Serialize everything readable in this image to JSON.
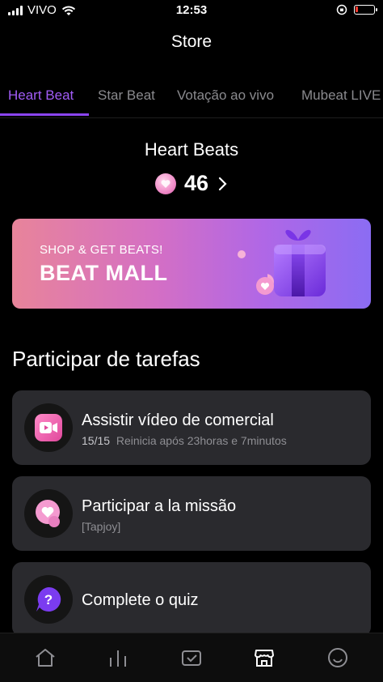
{
  "status": {
    "carrier": "VIVO",
    "time": "12:53",
    "battery_level": 0.15
  },
  "header": {
    "title": "Store"
  },
  "tabs": [
    {
      "label": "Heart Beat",
      "active": true
    },
    {
      "label": "Star Beat",
      "active": false
    },
    {
      "label": "Votação ao vivo",
      "active": false
    },
    {
      "label": "Mubeat LIVE",
      "active": false
    }
  ],
  "beats": {
    "title": "Heart Beats",
    "count": "46"
  },
  "banner": {
    "subtitle": "SHOP & GET BEATS!",
    "title": "BEAT MALL"
  },
  "tasks_section": {
    "title": "Participar de tarefas"
  },
  "tasks": [
    {
      "title": "Assistir vídeo de comercial",
      "progress": "15/15",
      "note": "Reinicia após 23horas e 7minutos",
      "icon": "video-icon"
    },
    {
      "title": "Participar a la missão",
      "note": "[Tapjoy]",
      "icon": "heart-bubble-icon"
    },
    {
      "title": "Complete o quiz",
      "icon": "quiz-icon"
    }
  ],
  "bottom_nav": [
    {
      "icon": "home-icon"
    },
    {
      "icon": "chart-icon"
    },
    {
      "icon": "vote-box-icon"
    },
    {
      "icon": "store-icon",
      "active": true
    },
    {
      "icon": "smile-icon"
    }
  ],
  "colors": {
    "accent": "#8b45f0",
    "background": "#000000",
    "card": "#2a2a2e"
  }
}
